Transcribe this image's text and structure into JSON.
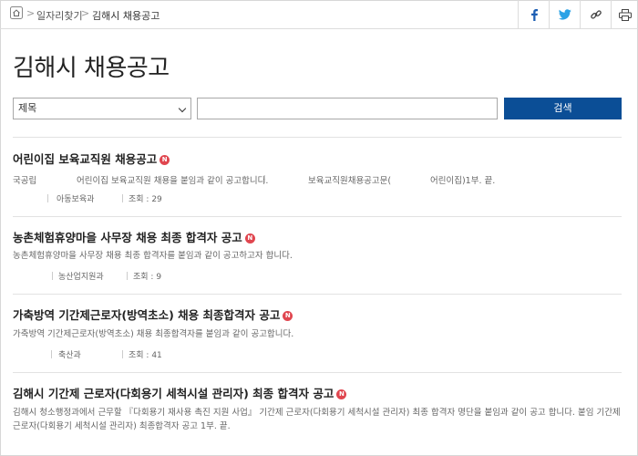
{
  "breadcrumb": {
    "level1": "일자리찾기",
    "level2": "김해시 채용공고"
  },
  "social": {
    "facebook_icon": "facebook-icon",
    "twitter_icon": "twitter-icon",
    "link_icon": "link-icon",
    "print_icon": "print-icon"
  },
  "page_title": "김해시 채용공고",
  "search": {
    "select_value": "제목",
    "input_value": "",
    "button_label": "검색"
  },
  "items": [
    {
      "title": "어린이집 보육교직원 채용공고",
      "badge": "N",
      "body_part1": "국공립",
      "body_part2": "어린이집 보육교직원 채용을 붙임과 같이 공고합니다.",
      "body_part3": "보육교직원채용공고문(",
      "body_part4": "어린이집)1부. 끝.",
      "dept": "아동보육과",
      "views": "조회 : 29"
    },
    {
      "title": "농촌체험휴양마을 사무장 채용 최종 합격자 공고",
      "badge": "N",
      "body": "농촌체험휴양마을 사무장 채용 최종 합격자를 붙임과 같이 공고하고자 합니다.",
      "dept": "농산업지원과",
      "views": "조회 : 9"
    },
    {
      "title": "가축방역 기간제근로자(방역초소) 채용 최종합격자 공고",
      "badge": "N",
      "body": "가축방역 기간제근로자(방역초소) 채용 최종합격자를 붙임과 같이 공고합니다.",
      "dept": "축산과",
      "views": "조회 : 41"
    },
    {
      "title": "김해시 기간제 근로자(다회용기 세척시설 관리자) 최종 합격자 공고",
      "badge": "N",
      "body": "김해시 청소행정과에서 근무할 『다회용기 재사용 촉진 지원 사업』 기간제 근로자(다회용기 세척시설 관리자) 최종 합격자 명단을 붙임과 같이 공고 합니다. 붙임 기간제근로자(다회용기 세척시설 관리자) 최종합격자 공고 1부. 끝."
    }
  ],
  "colors": {
    "accent_blue": "#0b4e96",
    "badge_red": "#e0464f",
    "facebook_blue": "#1d5fb4",
    "twitter_blue": "#2ba2e6"
  }
}
